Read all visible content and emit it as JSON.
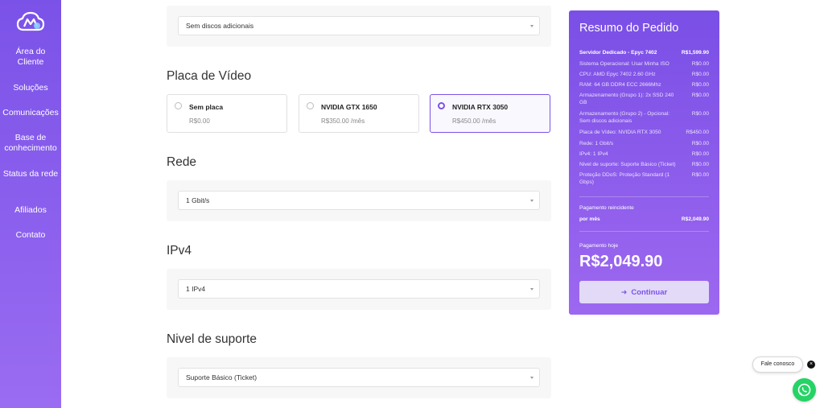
{
  "sidebar": {
    "items": [
      {
        "label": "Área do Cliente"
      },
      {
        "label": "Soluções"
      },
      {
        "label": "Comunicações"
      },
      {
        "label": "Base de conhecimento"
      },
      {
        "label": "Status da rede"
      },
      {
        "label": "Afiliados"
      },
      {
        "label": "Contato"
      }
    ]
  },
  "disks": {
    "value": "Sem discos adicionais"
  },
  "gpu": {
    "title": "Placa de Vídeo",
    "options": [
      {
        "name": "Sem placa",
        "price": "R$0.00",
        "selected": false
      },
      {
        "name": "NVIDIA GTX 1650",
        "price": "R$350.00 /mês",
        "selected": false
      },
      {
        "name": "NVIDIA RTX 3050",
        "price": "R$450.00 /mês",
        "selected": true
      }
    ]
  },
  "network": {
    "title": "Rede",
    "value": "1 Gbit/s"
  },
  "ipv4": {
    "title": "IPv4",
    "value": "1 IPv4"
  },
  "support": {
    "title": "Nivel de suporte",
    "value": "Suporte Básico (Ticket)"
  },
  "summary": {
    "title": "Resumo do Pedido",
    "product": {
      "label": "Servidor Dedicado - Epyc 7402",
      "price": "R$1,599.90"
    },
    "lines": [
      {
        "label": "Sistema Operacional: Usar Minha ISO",
        "price": "R$0.00"
      },
      {
        "label": "CPU: AMD Epyc 7402 2.60 GHz",
        "price": "R$0.00"
      },
      {
        "label": "RAM: 64 GB DDR4 ECC 2666Mhz",
        "price": "R$0.00"
      },
      {
        "label": "Armazenamento (Grupo 1): 2x SSD 240 GB",
        "price": "R$0.00"
      },
      {
        "label": "Armazenamento (Grupo 2) - Opcional: Sem discos adicionais",
        "price": "R$0.00"
      },
      {
        "label": "Placa de Vídeo: NVIDIA RTX 3050",
        "price": "R$450.00"
      },
      {
        "label": "Rede: 1 Gbit/s",
        "price": "R$0.00"
      },
      {
        "label": "IPv4: 1 IPv4",
        "price": "R$0.00"
      },
      {
        "label": "Nivel de suporte: Suporte Básico (Ticket)",
        "price": "R$0.00"
      },
      {
        "label": "Proteção DDoS: Proteção Standard (1 Gbps)",
        "price": "R$0.00"
      }
    ],
    "recurring_label": "Pagamento reincidente",
    "recurring_period": "por mês",
    "recurring_price": "R$2,049.90",
    "today_label": "Pagamento hoje",
    "today_total": "R$2,049.90",
    "continue_label": "Continuar"
  },
  "chat": {
    "label": "Fale conosco",
    "close": "×"
  },
  "colors": {
    "accent": "#7b52e8",
    "whatsapp": "#25d366"
  }
}
